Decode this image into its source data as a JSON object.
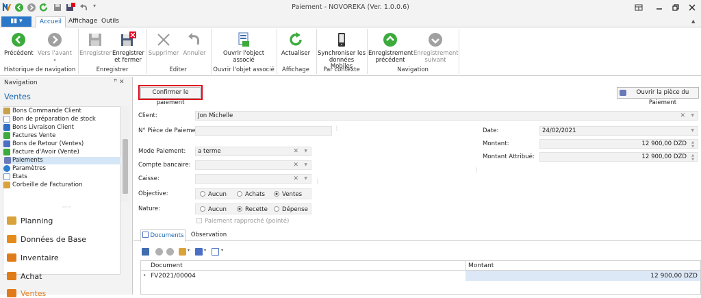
{
  "window": {
    "title": "Paiement - NOVOREKA (Ver. 1.0.0.6)"
  },
  "ribbon": {
    "file_label": "▮▮ ▾",
    "tabs": [
      "Accueil",
      "Affichage",
      "Outils"
    ],
    "buttons": {
      "precedent": "Précédent",
      "vers_avant": "Vers l'avant",
      "enregistrer": "Enregistrer",
      "enregistrer_fermer_1": "Enregistrer",
      "enregistrer_fermer_2": "et fermer",
      "supprimer": "Supprimer",
      "annuler": "Annuler",
      "ouvrir_objet_1": "Ouvrir l'object",
      "ouvrir_objet_2": "associé",
      "actualiser": "Actualiser",
      "sync_1": "Synchroniser les",
      "sync_2": "données Mobiles",
      "enr_prec_1": "Enregistrement",
      "enr_prec_2": "précédent",
      "enr_suiv_1": "Enregistrement",
      "enr_suiv_2": "suivant"
    },
    "groups": {
      "historique": "Historique de navigation",
      "enregistrer": "Enregistrer",
      "editer": "Editer",
      "ouvrir": "Ouvrir l'objet associé",
      "affichage": "Affichage",
      "contexte": "Par contexte",
      "navigation": "Navigation"
    }
  },
  "navigation": {
    "header": "Navigation",
    "pin": "ꟸ ✕",
    "title": "Ventes",
    "items": [
      "Bons Commande Client",
      "Bon de préparation de stock",
      "Bons Livraison Client",
      "Factures Vente",
      "Bons de Retour (Ventes)",
      "Facture d'Avoir (Vente)",
      "Paiements",
      "Paramètres",
      "Etats",
      "Corbeille de Facturation"
    ],
    "selected": "Paiements",
    "groups": [
      "Planning",
      "Données de Base",
      "Inventaire",
      "Achat",
      "Ventes"
    ]
  },
  "colors": {
    "accent": "#1a66b0",
    "highlight": "#e0001b",
    "green": "#3cab3c"
  },
  "form": {
    "confirm_button": "Confirmer le paiement",
    "open_piece_button": "Ouvrir la pièce du Paiement",
    "client_label": "Client:",
    "client_value": "Jon Michelle",
    "piece_label": "N° Pièce de Paiement:",
    "piece_value": "",
    "mode_label": "Mode Paiement:",
    "mode_value": "a terme",
    "compte_label": "Compte bancaire:",
    "compte_value": "",
    "caisse_label": "Caisse:",
    "caisse_value": "",
    "objective_label": "Objective:",
    "objective_options": [
      "Aucun",
      "Achats",
      "Ventes"
    ],
    "objective_selected": "Ventes",
    "nature_label": "Nature:",
    "nature_options": [
      "Aucun",
      "Recette",
      "Dépense"
    ],
    "nature_selected": "Recette",
    "rapproche_label": "Paiement rapproché (pointé)",
    "date_label": "Date:",
    "date_value": "24/02/2021",
    "montant_label": "Montant:",
    "montant_value": "12 900,00 DZD",
    "montant_attr_label": "Montant Attribué:",
    "montant_attr_value": "12 900,00 DZD"
  },
  "detail": {
    "tabs": [
      "Documents",
      "Observation"
    ],
    "columns": [
      "Document",
      "Montant"
    ],
    "rows": [
      {
        "document": "FV2021/00004",
        "montant": "12 900,00 DZD"
      }
    ]
  }
}
